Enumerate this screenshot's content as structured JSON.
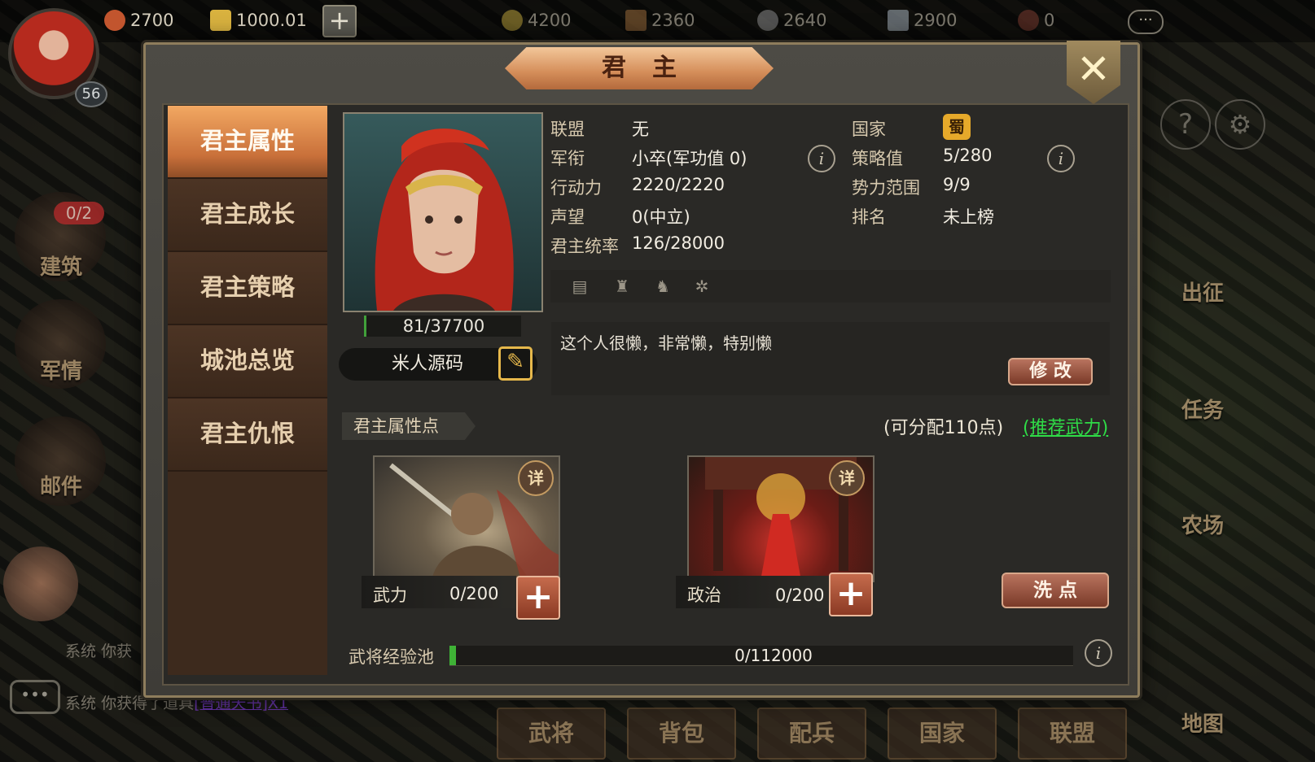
{
  "topbar": {
    "copper": "2700",
    "gold": "1000.01",
    "food": "4200",
    "wood": "2360",
    "stone": "2640",
    "iron": "2900",
    "pop": "0",
    "more": "···"
  },
  "player": {
    "level": "56"
  },
  "left_menu": [
    {
      "label": "建筑",
      "badge": "0/2"
    },
    {
      "label": "军情"
    },
    {
      "label": "邮件"
    }
  ],
  "right_menu": [
    "出征",
    "任务",
    "农场",
    "地图"
  ],
  "bottom_tabs": [
    "武将",
    "背包",
    "配兵",
    "国家",
    "联盟"
  ],
  "chat": [
    {
      "prefix": "系统",
      "text": "你获"
    },
    {
      "prefix": "系统",
      "text": "你获得了道具",
      "link": "[普通天书]X1"
    }
  ],
  "modal": {
    "title": "君主",
    "close": "✕",
    "tabs": [
      "君主属性",
      "君主成长",
      "君主策略",
      "城池总览",
      "君主仇恨"
    ],
    "exp": "81/37700",
    "name": "米人源码",
    "info_left": [
      {
        "label": "联盟",
        "value": "无"
      },
      {
        "label": "军衔",
        "value": "小卒(军功值 0)"
      },
      {
        "label": "行动力",
        "value": "2220/2220"
      },
      {
        "label": "声望",
        "value": "0(中立)"
      },
      {
        "label": "君主统率",
        "value": "126/28000"
      }
    ],
    "info_right": [
      {
        "label": "国家",
        "value": "蜀"
      },
      {
        "label": "策略值",
        "value": "5/280"
      },
      {
        "label": "势力范围",
        "value": "9/9"
      },
      {
        "label": "排名",
        "value": "未上榜"
      }
    ],
    "signature": "这个人很懒，非常懒，特别懒",
    "edit_btn": "修 改",
    "attr_section": "君主属性点",
    "available": "(可分配110点)",
    "recommend": "(推荐武力)",
    "detail": "详",
    "attrs": [
      {
        "label": "武力",
        "value": "0/200"
      },
      {
        "label": "政治",
        "value": "0/200"
      }
    ],
    "reset_btn": "洗 点",
    "exp_pool_label": "武将经验池",
    "exp_pool": "0/112000",
    "exp_pool_fraction": 0
  }
}
